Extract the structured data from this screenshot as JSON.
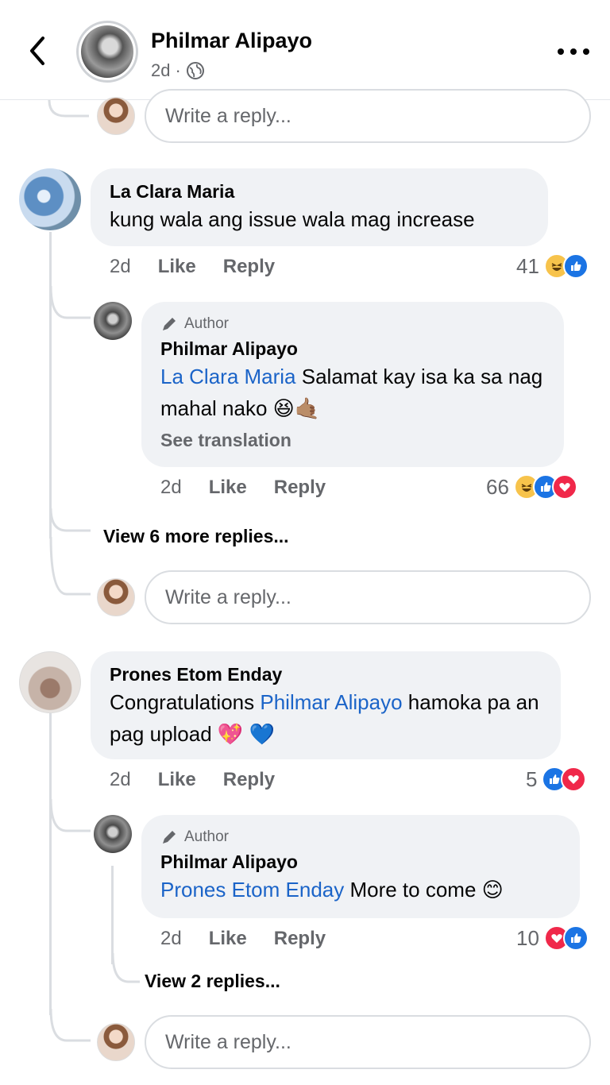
{
  "header": {
    "title": "Philmar Alipayo",
    "time": "2d",
    "separator": "·"
  },
  "reply_placeholder": "Write a reply...",
  "comments": [
    {
      "author": "La Clara Maria",
      "text": "kung wala ang issue wala mag increase",
      "time": "2d",
      "like_label": "Like",
      "reply_label": "Reply",
      "reaction_count": "41",
      "reactions": [
        "haha-icon",
        "like-icon"
      ],
      "replies": [
        {
          "badge": "Author",
          "author": "Philmar Alipayo",
          "mention": "La Clara Maria",
          "text": "Salamat kay isa ka sa nag mahal nako",
          "emoji": "😆🤙🏽",
          "see_translation": "See translation",
          "time": "2d",
          "like_label": "Like",
          "reply_label": "Reply",
          "reaction_count": "66",
          "reactions": [
            "haha-icon",
            "like-icon",
            "love-icon"
          ]
        }
      ],
      "view_more": "View 6 more replies..."
    },
    {
      "author": "Prones Etom Enday",
      "text_before": "Congratulations",
      "mention": "Philmar Alipayo",
      "text_after": "hamoka pa an pag upload",
      "emoji": "💖 💙",
      "time": "2d",
      "like_label": "Like",
      "reply_label": "Reply",
      "reaction_count": "5",
      "reactions": [
        "like-icon",
        "love-icon"
      ],
      "replies": [
        {
          "badge": "Author",
          "author": "Philmar Alipayo",
          "mention": "Prones Etom Enday",
          "text": "More to come",
          "emoji": "😊",
          "time": "2d",
          "like_label": "Like",
          "reply_label": "Reply",
          "reaction_count": "10",
          "reactions": [
            "love-icon",
            "like-icon"
          ]
        }
      ],
      "view_more": "View 2 replies..."
    }
  ],
  "colors": {
    "mention": "#1b64c8",
    "bubble": "#f0f2f5",
    "secondary_text": "#65676b",
    "like": "#1b74e4",
    "love": "#f0284a",
    "haha": "#f7c34b"
  }
}
